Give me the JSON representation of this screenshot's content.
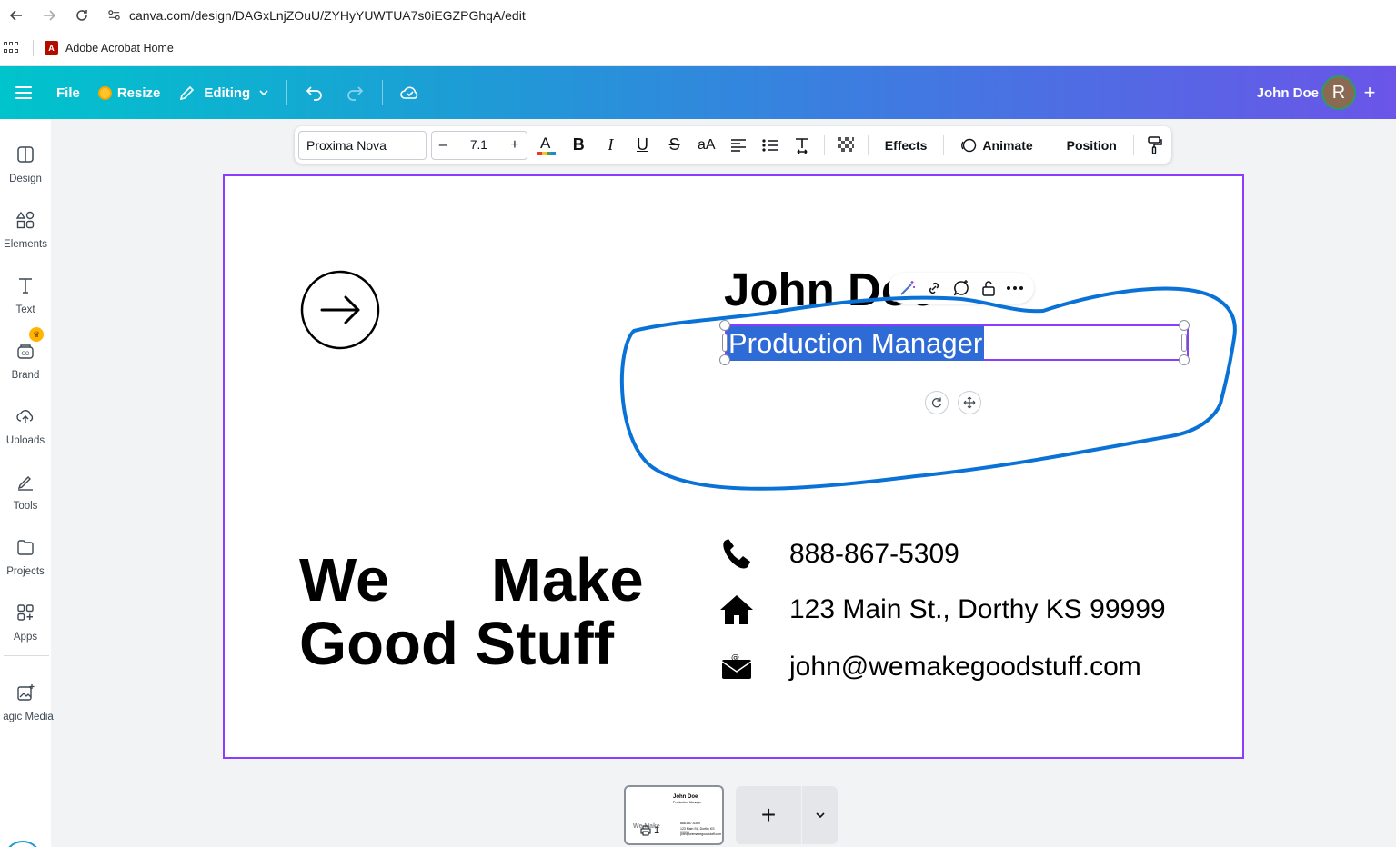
{
  "browser": {
    "url": "canva.com/design/DAGxLnjZOuU/ZYHyYUWTUA7s0iEGZPGhqA/edit",
    "bookmark_label": "Adobe Acrobat Home"
  },
  "topbar": {
    "file_label": "File",
    "resize_label": "Resize",
    "editing_label": "Editing",
    "user_name": "John Doe",
    "avatar_letter": "R",
    "plus_label": "+"
  },
  "sidebar": {
    "items": [
      {
        "label": "Design",
        "icon": "design-icon"
      },
      {
        "label": "Elements",
        "icon": "elements-icon"
      },
      {
        "label": "Text",
        "icon": "text-icon"
      },
      {
        "label": "Brand",
        "icon": "brand-icon"
      },
      {
        "label": "Uploads",
        "icon": "uploads-icon"
      },
      {
        "label": "Tools",
        "icon": "tools-icon"
      },
      {
        "label": "Projects",
        "icon": "projects-icon"
      },
      {
        "label": "Apps",
        "icon": "apps-icon"
      },
      {
        "label": "agic Media",
        "icon": "magic-media-icon"
      }
    ]
  },
  "text_toolbar": {
    "font_name": "Proxima Nova",
    "font_size": "7.1",
    "minus": "–",
    "plus": "+",
    "effects_label": "Effects",
    "animate_label": "Animate",
    "position_label": "Position",
    "case_label": "aA"
  },
  "design": {
    "name": "John Doe",
    "role": "Production Manager",
    "tagline": "We      Make\nGood Stuff",
    "phone": "888-867-5309",
    "address": "123 Main St., Dorthy KS 99999",
    "email": "john@wemakegoodstuff.com",
    "annotation_color": "#0a72d6",
    "selection_color": "#8b3dff",
    "highlight_color": "#2f6bd6"
  },
  "pages": {
    "current_page": "1",
    "add_page_label": "+",
    "thumb_name": "John Doe",
    "thumb_role": "Production Manager",
    "thumb_tagline": "We Make",
    "thumb_phone": "888-867-5309",
    "thumb_address": "123 Main St., Dorthy KS 99999",
    "thumb_email": "john@wemakegoodstuff.com"
  }
}
